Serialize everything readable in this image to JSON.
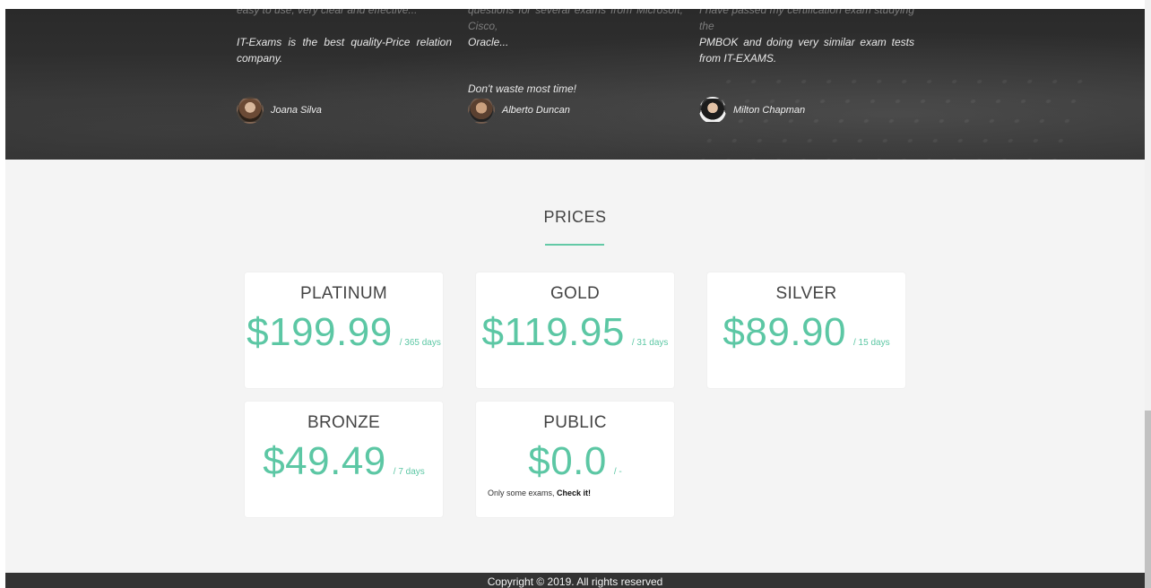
{
  "testimonials": [
    {
      "cut_line": "easy to use, very clear and effective...",
      "text": "IT-Exams is the best quality-Price relation company.",
      "author": "Joana Silva"
    },
    {
      "cut_line": "questions for several exams from Microsoft, Cisco,",
      "text": "Oracle...",
      "extra": "Don't waste most time!",
      "author": "Alberto Duncan"
    },
    {
      "cut_line": "I have passed my certification exam studying the",
      "text": "PMBOK and doing very similar exam tests from IT-EXAMS.",
      "author": "Milton Chapman"
    }
  ],
  "prices": {
    "title": "PRICES",
    "plans": [
      {
        "name": "PLATINUM",
        "amount": "$199.99",
        "period": "/ 365 days"
      },
      {
        "name": "GOLD",
        "amount": "$119.95",
        "period": "/ 31 days"
      },
      {
        "name": "SILVER",
        "amount": "$89.90",
        "period": "/ 15 days"
      },
      {
        "name": "BRONZE",
        "amount": "$49.49",
        "period": "/ 7 days"
      },
      {
        "name": "PUBLIC",
        "amount": "$0.0",
        "period": "/ -",
        "note": "Only some exams,",
        "note_link": "Check it!"
      }
    ]
  },
  "footer": {
    "copyright": "Copyright © 2019. All rights reserved"
  },
  "colors": {
    "accent": "#5cc7a4",
    "dark_band": "#2e2e2e",
    "footer": "#333333"
  }
}
